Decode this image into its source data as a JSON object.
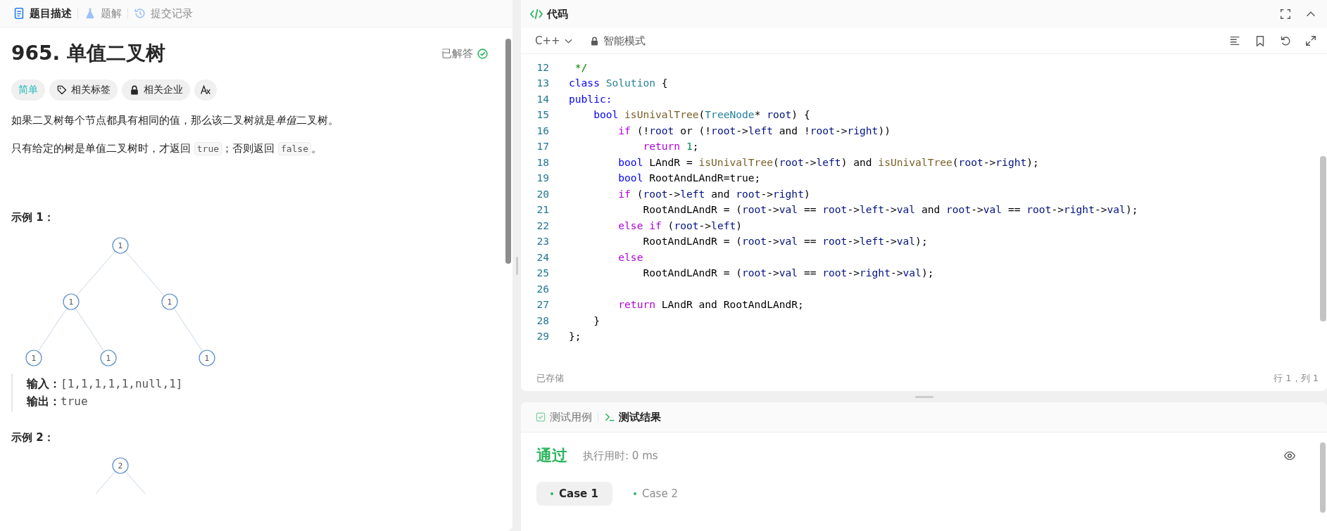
{
  "left_tabs": [
    {
      "label": "题目描述",
      "selected": true
    },
    {
      "label": "题解",
      "selected": false
    },
    {
      "label": "提交记录",
      "selected": false
    }
  ],
  "problem": {
    "title": "965. 单值二叉树",
    "status": "已解答",
    "solved": true,
    "tags": [
      {
        "kind": "difficulty",
        "label": "简单"
      },
      {
        "kind": "tag",
        "label": "相关标签"
      },
      {
        "kind": "lock",
        "label": "相关企业"
      },
      {
        "kind": "translate"
      }
    ],
    "paragraphs": [
      [
        {
          "kind": "text",
          "text": "如果二叉树每个节点都具有相同的值，那么该二叉树就是"
        },
        {
          "kind": "em",
          "text": "单值"
        },
        {
          "kind": "text",
          "text": "二叉树。"
        }
      ],
      [
        {
          "kind": "text",
          "text": "只有给定的树是单值二叉树时，才返回 "
        },
        {
          "kind": "code",
          "text": "true"
        },
        {
          "kind": "text",
          "text": "；否则返回 "
        },
        {
          "kind": "code",
          "text": "false"
        },
        {
          "kind": "text",
          "text": "。"
        }
      ]
    ],
    "examples": [
      {
        "heading": "示例 1：",
        "tree": {
          "value": "1",
          "children": [
            {
              "kind": "left",
              "value": "1",
              "children": [
                {
                  "kind": "left",
                  "value": "1"
                },
                {
                  "kind": "right",
                  "value": "1"
                }
              ]
            },
            {
              "kind": "right",
              "value": "1",
              "children": [
                {
                  "kind": "right",
                  "value": "1"
                }
              ]
            }
          ]
        },
        "io": [
          {
            "label": "输入：",
            "value": "[1,1,1,1,1,null,1]"
          },
          {
            "label": "输出：",
            "value": "true"
          }
        ]
      },
      {
        "heading": "示例 2：",
        "tree": {
          "value": "2",
          "children": [
            {
              "kind": "left"
            },
            {
              "kind": "right"
            }
          ]
        }
      }
    ]
  },
  "code": {
    "title": "代码",
    "language": "C++",
    "mode": "智能模式",
    "lines": [
      {
        "number": "12",
        "tokens": [
          {
            "kind": "comment",
            "text": " */"
          }
        ]
      },
      {
        "number": "13",
        "tokens": [
          {
            "kind": "type",
            "text": "class"
          },
          {
            "kind": "class",
            "text": " Solution"
          },
          {
            "kind": "plain",
            "text": " {"
          }
        ]
      },
      {
        "number": "14",
        "tokens": [
          {
            "kind": "type",
            "text": "public:"
          }
        ]
      },
      {
        "number": "15",
        "tokens": [
          {
            "kind": "type",
            "text": "    bool"
          },
          {
            "kind": "func",
            "text": " isUnivalTree"
          },
          {
            "kind": "plain",
            "text": "("
          },
          {
            "kind": "class",
            "text": "TreeNode"
          },
          {
            "kind": "plain",
            "text": "* "
          },
          {
            "kind": "var",
            "text": "root"
          },
          {
            "kind": "plain",
            "text": ") {"
          }
        ]
      },
      {
        "number": "16",
        "tokens": [
          {
            "kind": "keyword",
            "text": "        if"
          },
          {
            "kind": "plain",
            "text": " (!"
          },
          {
            "kind": "var",
            "text": "root"
          },
          {
            "kind": "plain",
            "text": " or (!"
          },
          {
            "kind": "var",
            "text": "root"
          },
          {
            "kind": "plain",
            "text": "->"
          },
          {
            "kind": "var",
            "text": "left"
          },
          {
            "kind": "plain",
            "text": " and !"
          },
          {
            "kind": "var",
            "text": "root"
          },
          {
            "kind": "plain",
            "text": "->"
          },
          {
            "kind": "var",
            "text": "right"
          },
          {
            "kind": "plain",
            "text": "))"
          }
        ]
      },
      {
        "number": "17",
        "tokens": [
          {
            "kind": "keyword",
            "text": "            return"
          },
          {
            "kind": "number",
            "text": " 1"
          },
          {
            "kind": "plain",
            "text": ";"
          }
        ]
      },
      {
        "number": "18",
        "tokens": [
          {
            "kind": "type",
            "text": "        bool"
          },
          {
            "kind": "plain",
            "text": " LAndR = "
          },
          {
            "kind": "func",
            "text": "isUnivalTree"
          },
          {
            "kind": "plain",
            "text": "("
          },
          {
            "kind": "var",
            "text": "root"
          },
          {
            "kind": "plain",
            "text": "->"
          },
          {
            "kind": "var",
            "text": "left"
          },
          {
            "kind": "plain",
            "text": ") and "
          },
          {
            "kind": "func",
            "text": "isUnivalTree"
          },
          {
            "kind": "plain",
            "text": "("
          },
          {
            "kind": "var",
            "text": "root"
          },
          {
            "kind": "plain",
            "text": "->"
          },
          {
            "kind": "var",
            "text": "right"
          },
          {
            "kind": "plain",
            "text": ");"
          }
        ]
      },
      {
        "number": "19",
        "tokens": [
          {
            "kind": "type",
            "text": "        bool"
          },
          {
            "kind": "plain",
            "text": " RootAndLAndR=true;"
          }
        ]
      },
      {
        "number": "20",
        "tokens": [
          {
            "kind": "keyword",
            "text": "        if"
          },
          {
            "kind": "plain",
            "text": " ("
          },
          {
            "kind": "var",
            "text": "root"
          },
          {
            "kind": "plain",
            "text": "->"
          },
          {
            "kind": "var",
            "text": "left"
          },
          {
            "kind": "plain",
            "text": " and "
          },
          {
            "kind": "var",
            "text": "root"
          },
          {
            "kind": "plain",
            "text": "->"
          },
          {
            "kind": "var",
            "text": "right"
          },
          {
            "kind": "plain",
            "text": ")"
          }
        ]
      },
      {
        "number": "21",
        "tokens": [
          {
            "kind": "plain",
            "text": "            RootAndLAndR = ("
          },
          {
            "kind": "var",
            "text": "root"
          },
          {
            "kind": "plain",
            "text": "->"
          },
          {
            "kind": "var",
            "text": "val"
          },
          {
            "kind": "plain",
            "text": " == "
          },
          {
            "kind": "var",
            "text": "root"
          },
          {
            "kind": "plain",
            "text": "->"
          },
          {
            "kind": "var",
            "text": "left"
          },
          {
            "kind": "plain",
            "text": "->"
          },
          {
            "kind": "var",
            "text": "val"
          },
          {
            "kind": "plain",
            "text": " and "
          },
          {
            "kind": "var",
            "text": "root"
          },
          {
            "kind": "plain",
            "text": "->"
          },
          {
            "kind": "var",
            "text": "val"
          },
          {
            "kind": "plain",
            "text": " == "
          },
          {
            "kind": "var",
            "text": "root"
          },
          {
            "kind": "plain",
            "text": "->"
          },
          {
            "kind": "var",
            "text": "right"
          },
          {
            "kind": "plain",
            "text": "->"
          },
          {
            "kind": "var",
            "text": "val"
          },
          {
            "kind": "plain",
            "text": ");"
          }
        ]
      },
      {
        "number": "22",
        "tokens": [
          {
            "kind": "keyword",
            "text": "        else if"
          },
          {
            "kind": "plain",
            "text": " ("
          },
          {
            "kind": "var",
            "text": "root"
          },
          {
            "kind": "plain",
            "text": "->"
          },
          {
            "kind": "var",
            "text": "left"
          },
          {
            "kind": "plain",
            "text": ")"
          }
        ]
      },
      {
        "number": "23",
        "tokens": [
          {
            "kind": "plain",
            "text": "            RootAndLAndR = ("
          },
          {
            "kind": "var",
            "text": "root"
          },
          {
            "kind": "plain",
            "text": "->"
          },
          {
            "kind": "var",
            "text": "val"
          },
          {
            "kind": "plain",
            "text": " == "
          },
          {
            "kind": "var",
            "text": "root"
          },
          {
            "kind": "plain",
            "text": "->"
          },
          {
            "kind": "var",
            "text": "left"
          },
          {
            "kind": "plain",
            "text": "->"
          },
          {
            "kind": "var",
            "text": "val"
          },
          {
            "kind": "plain",
            "text": ");"
          }
        ]
      },
      {
        "number": "24",
        "tokens": [
          {
            "kind": "keyword",
            "text": "        else"
          }
        ]
      },
      {
        "number": "25",
        "tokens": [
          {
            "kind": "plain",
            "text": "            RootAndLAndR = ("
          },
          {
            "kind": "var",
            "text": "root"
          },
          {
            "kind": "plain",
            "text": "->"
          },
          {
            "kind": "var",
            "text": "val"
          },
          {
            "kind": "plain",
            "text": " == "
          },
          {
            "kind": "var",
            "text": "root"
          },
          {
            "kind": "plain",
            "text": "->"
          },
          {
            "kind": "var",
            "text": "right"
          },
          {
            "kind": "plain",
            "text": "->"
          },
          {
            "kind": "var",
            "text": "val"
          },
          {
            "kind": "plain",
            "text": ");"
          }
        ]
      },
      {
        "number": "26"
      },
      {
        "number": "27",
        "tokens": [
          {
            "kind": "keyword",
            "text": "        return"
          },
          {
            "kind": "plain",
            "text": " LAndR and RootAndLAndR;"
          }
        ]
      },
      {
        "number": "28",
        "tokens": [
          {
            "kind": "plain",
            "text": "    }"
          }
        ]
      },
      {
        "number": "29",
        "tokens": [
          {
            "kind": "plain",
            "text": "};"
          }
        ]
      }
    ],
    "saved": "已存储",
    "cursor": "行 1，列 1"
  },
  "results": {
    "tabs": [
      {
        "label": "测试用例",
        "selected": false
      },
      {
        "label": "测试结果",
        "selected": true
      }
    ],
    "verdict": "通过",
    "runtime": "执行用时: 0 ms",
    "cases": [
      {
        "label": "Case 1",
        "selected": true,
        "passed": true
      },
      {
        "label": "Case 2",
        "selected": false,
        "passed": true
      }
    ]
  }
}
